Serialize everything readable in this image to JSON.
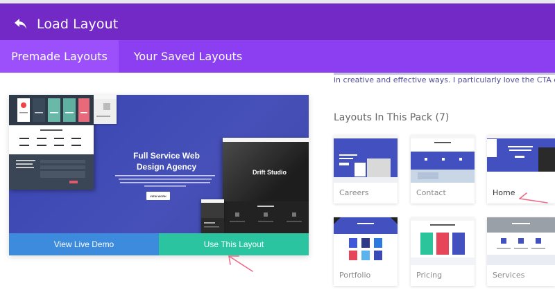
{
  "header": {
    "title": "Load Layout",
    "back_icon": "undo-arrow-icon"
  },
  "tabs": [
    {
      "label": "Premade Layouts",
      "active": true
    },
    {
      "label": "Your Saved Layouts",
      "active": false
    }
  ],
  "preview": {
    "hero_title_line1": "Full Service Web",
    "hero_title_line2": "Design Agency",
    "hero_button": "VIEW WORK",
    "secondary_title": "Drift Studio",
    "view_demo_label": "View Live Demo",
    "use_layout_label": "Use This Layout"
  },
  "description": {
    "text": "in creative and effective ways. I particularly love the CTA on the"
  },
  "pack": {
    "title": "Layouts In This Pack (7)",
    "layouts": [
      {
        "label": "Careers",
        "active": false
      },
      {
        "label": "Contact",
        "active": false
      },
      {
        "label": "Home",
        "active": true
      },
      {
        "label": "Portfolio",
        "active": false
      },
      {
        "label": "Pricing",
        "active": false
      },
      {
        "label": "Services",
        "active": false
      }
    ]
  },
  "colors": {
    "header": "#7329c6",
    "tabs": "#8b3ff0",
    "active_tab": "#9b50fb",
    "demo_button": "#3d8bdd",
    "use_button": "#2bc4a0",
    "annotation": "#f06a8a"
  }
}
